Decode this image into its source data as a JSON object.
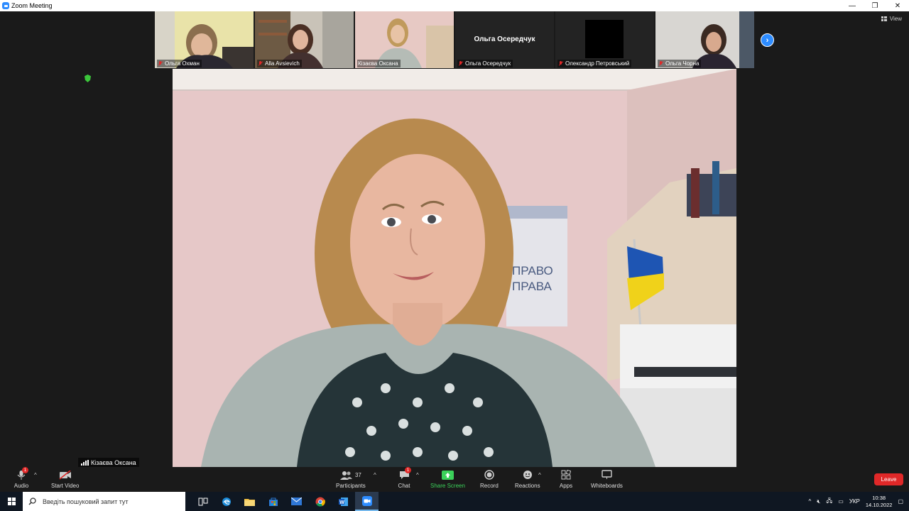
{
  "window": {
    "title": "Zoom Meeting",
    "controls": [
      "—",
      "❐",
      "✕"
    ]
  },
  "participants": [
    {
      "name": "Ольга Охман",
      "muted": true,
      "video": true
    },
    {
      "name": "Alla Avsievich",
      "muted": true,
      "video": true
    },
    {
      "name": "Кізаєва Оксана",
      "muted": false,
      "video": true,
      "active": true
    },
    {
      "name": "Ольга Осередчук",
      "muted": true,
      "video": false,
      "center_name": "Ольга Осередчук"
    },
    {
      "name": "Олександр Петровський",
      "muted": true,
      "video": false
    },
    {
      "name": "Ольга Чорна",
      "muted": true,
      "video": true
    }
  ],
  "view_label": "View",
  "main_speaker": {
    "name": "Кізаєва Оксана",
    "banner_line1": "ПРАВО",
    "banner_line2": "ПРАВА"
  },
  "toolbar": {
    "audio": "Audio",
    "audio_badge": "1",
    "start_video": "Start Video",
    "participants": "Participants",
    "participants_count": "37",
    "chat": "Chat",
    "chat_badge": "1",
    "share_screen": "Share Screen",
    "record": "Record",
    "reactions": "Reactions",
    "apps": "Apps",
    "whiteboards": "Whiteboards",
    "leave": "Leave"
  },
  "taskbar": {
    "search_placeholder": "Введіть пошуковий запит тут",
    "language": "УКР",
    "time": "10:38",
    "date": "14.10.2022"
  },
  "colors": {
    "zoom_blue": "#2d8cff",
    "leave_red": "#e02828",
    "share_green": "#3bd15a",
    "active_border": "#8bd33d"
  }
}
